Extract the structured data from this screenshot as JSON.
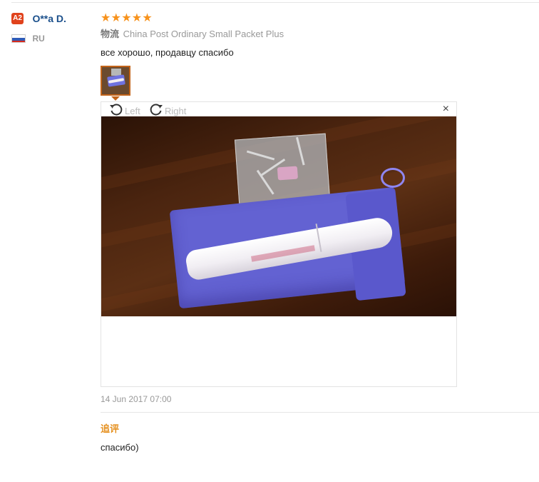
{
  "reviewer": {
    "level_badge": "A2",
    "name": "O**a D.",
    "country": "RU"
  },
  "review": {
    "rating": 5,
    "star_glyph": "★",
    "shipping_label": "物流",
    "shipping_method": "China Post Ordinary Small Packet Plus",
    "text": "все хорошо, продавцу спасибо",
    "date": "14 Jun 2017 07:00"
  },
  "image_viewer": {
    "rotate_left_label": "Left",
    "rotate_right_label": "Right",
    "close_glyph": "×",
    "rotate_left_icon": "rotate-left-icon",
    "rotate_right_icon": "rotate-right-icon"
  },
  "additional_feedback": {
    "title": "追评",
    "text": "спасибо)"
  },
  "colors": {
    "star": "#f7921c",
    "username": "#1a4f8b",
    "badge": "#e0421c",
    "append_title": "#e5901f",
    "thumb_border": "#c2641a"
  }
}
